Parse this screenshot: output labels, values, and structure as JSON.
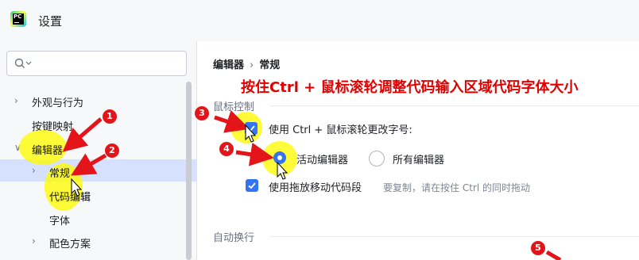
{
  "window": {
    "title": "设置",
    "app_icon": "pycharm-logo-icon"
  },
  "search": {
    "placeholder": "",
    "icon": "search-icon"
  },
  "sidebar": {
    "items": [
      {
        "label": "外观与行为",
        "expandable": true,
        "expanded": false
      },
      {
        "label": "按键映射",
        "expandable": false
      },
      {
        "label": "编辑器",
        "expandable": true,
        "expanded": true
      },
      {
        "label": "常规",
        "expandable": true,
        "expanded": false,
        "selected": true
      },
      {
        "label": "代码编辑",
        "expandable": false
      },
      {
        "label": "字体",
        "expandable": false
      },
      {
        "label": "配色方案",
        "expandable": true,
        "expanded": false
      }
    ]
  },
  "breadcrumb": {
    "parent": "编辑器",
    "current": "常规"
  },
  "annotation_text": "按住Ctrl + 鼠标滚轮调整代码输入区域代码字体大小",
  "mouse_section": {
    "title": "鼠标控制",
    "ctrl_wheel_font_label": "使用 Ctrl + 鼠标滚轮更改字号:",
    "ctrl_wheel_font_checked": true,
    "radio_active_label": "活动编辑器",
    "radio_all_label": "所有编辑器",
    "radio_selected": "active",
    "drag_move_label": "使用拖放移动代码段",
    "drag_move_checked": true,
    "drag_move_hint": "要复制，请在按住 Ctrl 的同时拖动"
  },
  "wrap_section": {
    "title": "自动换行"
  },
  "callouts": [
    "1",
    "2",
    "3",
    "4",
    "5"
  ],
  "colors": {
    "accent": "#3574f0",
    "selection": "#d5e1ff",
    "callout_red": "#e3141a",
    "annotation_red": "#e00000",
    "highlight_yellow": "#fffa00"
  }
}
